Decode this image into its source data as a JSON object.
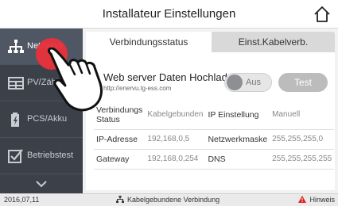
{
  "header": {
    "title": "Installateur Einstellungen",
    "home_icon": "home-icon"
  },
  "sidebar": {
    "items": [
      {
        "label": "Netzwerk",
        "icon": "network-icon",
        "active": true
      },
      {
        "label": "PV/Zähler",
        "icon": "meter-icon",
        "active": false
      },
      {
        "label": "PCS/Akku",
        "icon": "battery-icon",
        "active": false
      },
      {
        "label": "Betriebstest",
        "icon": "checkbox-icon",
        "active": false
      }
    ],
    "more_icon": "chevron-down-icon"
  },
  "tabs": [
    {
      "label": "Verbindungsstatus",
      "active": true
    },
    {
      "label": "Einst.Kabelverb.",
      "active": false
    }
  ],
  "upload": {
    "label": "Web server Daten Hochladen",
    "url": "http://enervu.lg-ess.com",
    "toggle_text": "Aus",
    "test_label": "Test"
  },
  "status_table": [
    {
      "k1": "Verbindungs Status",
      "v1": "Kabelgebunden",
      "k2": "IP Einstellung",
      "v2": "Manuell"
    },
    {
      "k1": "IP-Adresse",
      "v1": "192,168,0,5",
      "k2": "Netzwerkmaske",
      "v2": "255,255,255,0"
    },
    {
      "k1": "Gateway",
      "v1": "192,168,0,254",
      "k2": "DNS",
      "v2": "255,255,255,255"
    }
  ],
  "statusbar": {
    "date": "2016,07,11",
    "connection": "Kabelgebundene Verbindung",
    "warning": "Hinweis"
  },
  "colors": {
    "sidebar_bg": "#3b4049",
    "sidebar_active": "#505764",
    "touch_dot": "#e8323b",
    "warning": "#e02020",
    "test_button": "#bcbcbc"
  }
}
